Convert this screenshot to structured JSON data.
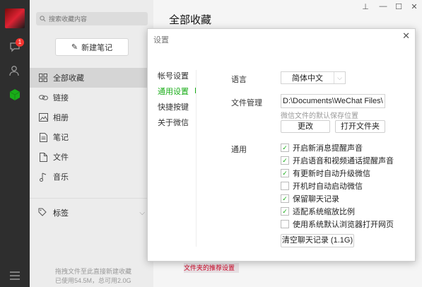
{
  "window": {
    "min_label": "—",
    "max_label": "☐",
    "close_label": "✕",
    "pin_label": "⊥"
  },
  "nav": {
    "badge_count": "1"
  },
  "search": {
    "placeholder": "搜索收藏内容"
  },
  "sidebar": {
    "new_note_label": "新建笔记",
    "items": [
      {
        "label": "全部收藏",
        "icon": "grid-icon"
      },
      {
        "label": "链接",
        "icon": "link-icon"
      },
      {
        "label": "相册",
        "icon": "image-icon"
      },
      {
        "label": "笔记",
        "icon": "note-icon"
      },
      {
        "label": "文件",
        "icon": "file-icon"
      },
      {
        "label": "音乐",
        "icon": "music-icon"
      }
    ],
    "tags_label": "标签",
    "storage_line1": "拖拽文件至此直接新建收藏",
    "storage_line2": "已使用54.5M，总可用2.0G"
  },
  "main": {
    "title": "全部收藏",
    "thumb_text": "文件夹的推荐设置"
  },
  "settings": {
    "title": "设置",
    "close_label": "✕",
    "nav": [
      "帐号设置",
      "通用设置",
      "快捷按键",
      "关于微信"
    ],
    "language_label": "语言",
    "language_value": "简体中文",
    "file_label": "文件管理",
    "file_path": "D:\\Documents\\WeChat Files\\",
    "file_hint": "微信文件的默认保存位置",
    "change_btn": "更改",
    "open_folder_btn": "打开文件夹",
    "general_label": "通用",
    "options": [
      {
        "label": "开启新消息提醒声音",
        "checked": true
      },
      {
        "label": "开启语音和视频通话提醒声音",
        "checked": true
      },
      {
        "label": "有更新时自动升级微信",
        "checked": true
      },
      {
        "label": "开机时自动启动微信",
        "checked": false
      },
      {
        "label": "保留聊天记录",
        "checked": true
      },
      {
        "label": "适配系统缩放比例",
        "checked": true
      },
      {
        "label": "使用系统默认浏览器打开网页",
        "checked": false
      }
    ],
    "clear_btn": "清空聊天记录 (1.1G)"
  },
  "colors": {
    "accent": "#1aad19",
    "nav_bg": "#2e2e2e",
    "badge": "#f43530"
  }
}
